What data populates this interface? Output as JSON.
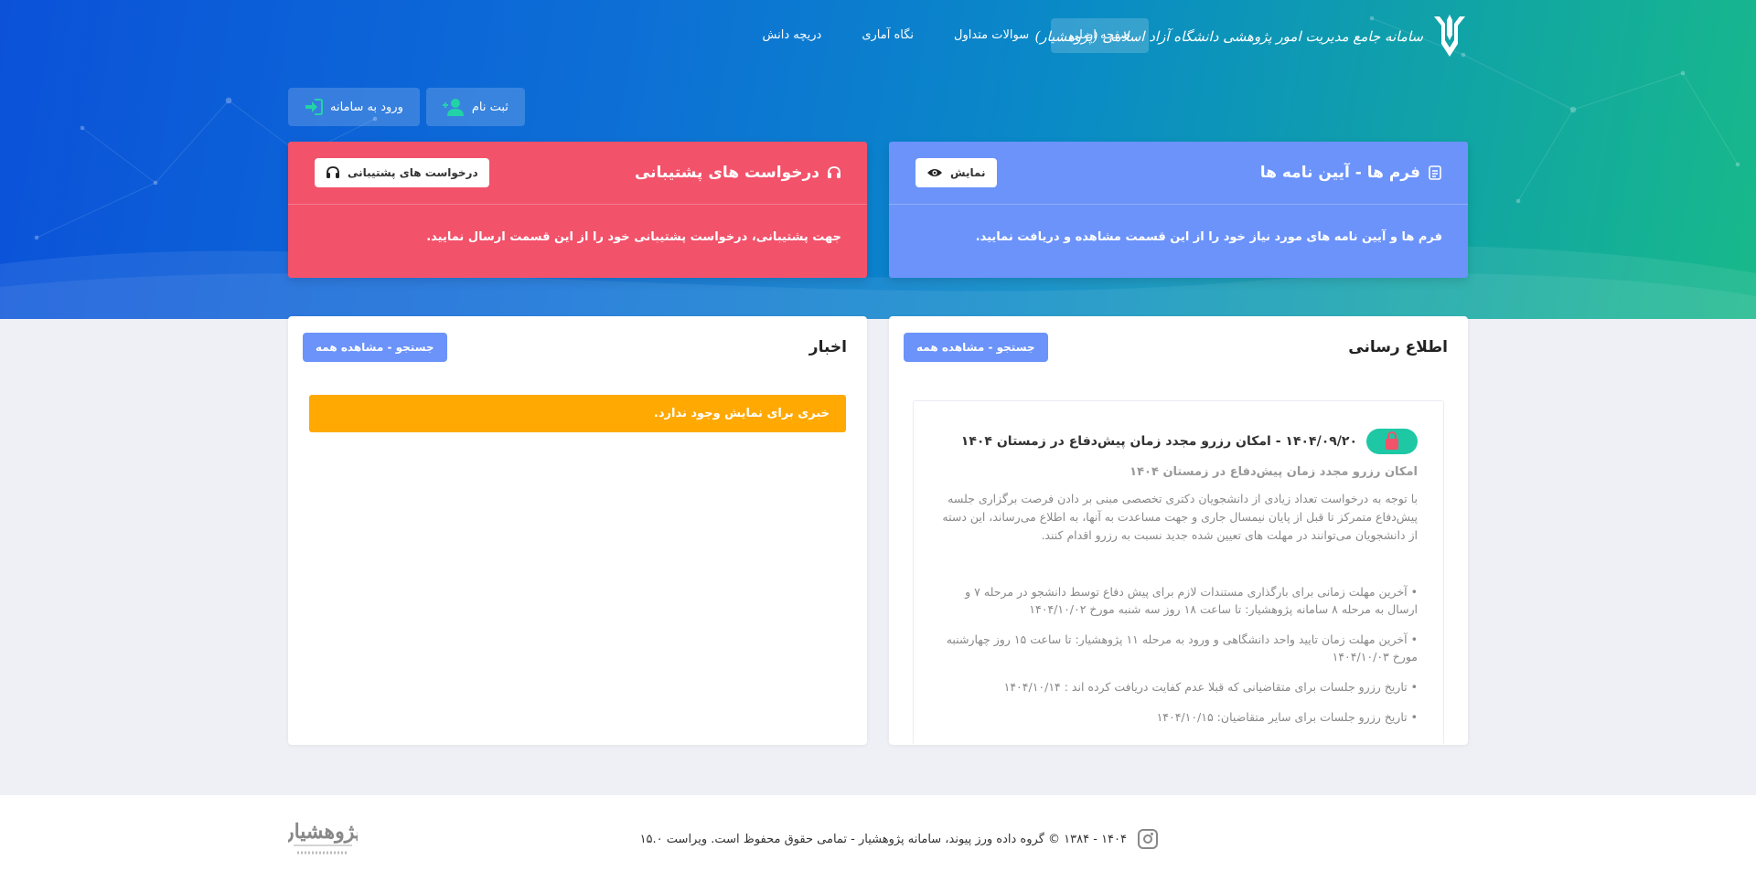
{
  "header": {
    "brand_title": "سامانه جامع مدیریت امور پژوهشی دانشگاه آزاد اسلامی (پژوهشیار)",
    "nav": [
      {
        "label": "صفحه اصلی",
        "active": true
      },
      {
        "label": "سوالات متداول",
        "active": false
      },
      {
        "label": "نگاه آماری",
        "active": false
      },
      {
        "label": "دریچه دانش",
        "active": false
      }
    ]
  },
  "auth": {
    "login_label": "ورود به سامانه",
    "register_label": "ثبت نام"
  },
  "cards": {
    "forms": {
      "title": "فرم ها - آیین نامه ها",
      "button": "نمایش",
      "body": "فرم ها و آیین نامه های مورد نیاز خود را از این قسمت مشاهده و دریافت نمایید.",
      "color": "#6b93fa"
    },
    "support": {
      "title": "درخواست های پشتیبانی",
      "button": "درخواست های پشتیبانی",
      "body": "جهت پشتیبانی، درخواست پشتیبانی خود را از این قسمت ارسال نمایید.",
      "color": "#f2526a"
    }
  },
  "announcements": {
    "title": "اطلاع رسانی",
    "button": "جستجو - مشاهده همه",
    "item": {
      "title": "۱۴۰۴/۰۹/۲۰ - امکان رزرو مجدد زمان پیش‌دفاع در زمستان ۱۴۰۴",
      "subtitle": "امکان رزرو مجدد زمان پیش‌دفاع در زمستان ۱۴۰۴",
      "text": "با توجه به درخواست تعداد زیادی از دانشجویان دکتری تخصصی مبنی بر دادن فرصت برگزاری جلسه پیش‌دفاع متمرکز تا قبل از پایان نیمسال جاری و جهت مساعدت به آنها، به اطلاع می‌رساند، این دسته از دانشجویان می‌توانند در مهلت های تعیین شده جدید نسبت به رزرو اقدام کنند.",
      "bullets": [
        "آخرین مهلت زمانی برای بارگذاری مستندات لازم برای پیش دفاع  توسط دانشجو در مرحله ۷ و ارسال به مرحله ۸ سامانه پژوهشیار: تا ساعت ۱۸ روز سه شنبه مورخ ۱۴۰۴/۱۰/۰۲",
        "آخرین مهلت زمان تایید واحد دانشگاهی و ورود به مرحله ۱۱ پژوهشیار:  تا ساعت ۱۵ روز چهارشنبه مورخ ۱۴۰۴/۱۰/۰۳",
        "تاریخ رزرو جلسات برای متقاضیانی که قبلا عدم کفایت دریافت کرده اند : ۱۴۰۴/۱۰/۱۴",
        "تاریخ رزرو جلسات برای سایر متقاضیان: ۱۴۰۴/۱۰/۱۵"
      ]
    }
  },
  "news": {
    "title": "اخبار",
    "button": "جستجو - مشاهده همه",
    "empty_message": "خبری برای نمایش وجود ندارد."
  },
  "footer": {
    "text": "۱۴۰۴ - ۱۳۸۴ © گروه داده ورز پیوند، سامانه پژوهشیار - تمامی حقوق محفوظ است. ویراست ۱۵.۰",
    "logo_text": "پژوهشیار"
  }
}
